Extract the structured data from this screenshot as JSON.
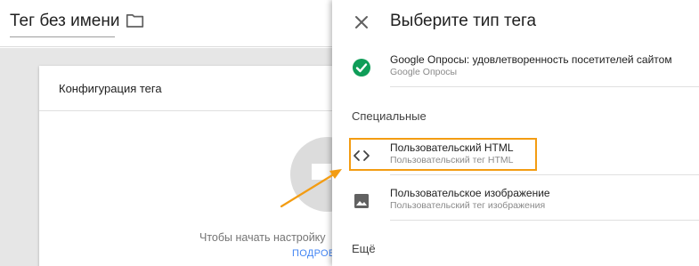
{
  "editor": {
    "tag_name": "Тег без имени",
    "config_title": "Конфигурация тега",
    "config_hint": "Чтобы начать настройку",
    "config_link": "ПОДРОБ"
  },
  "panel": {
    "title": "Выберите тип тега",
    "items": [
      {
        "name": "Google Опросы: удовлетворенность посетителей сайтом",
        "desc": "Google Опросы",
        "icon": "check-circle-icon"
      },
      {
        "name": "Пользовательский HTML",
        "desc": "Пользовательский тег HTML",
        "icon": "code-icon"
      },
      {
        "name": "Пользовательское изображение",
        "desc": "Пользовательский тег изображения",
        "icon": "image-icon"
      }
    ],
    "sections": {
      "special": "Специальные",
      "more": "Ещё"
    }
  },
  "colors": {
    "check_green": "#0f9d58",
    "highlight": "#f39c12",
    "link_blue": "#4285f4"
  }
}
